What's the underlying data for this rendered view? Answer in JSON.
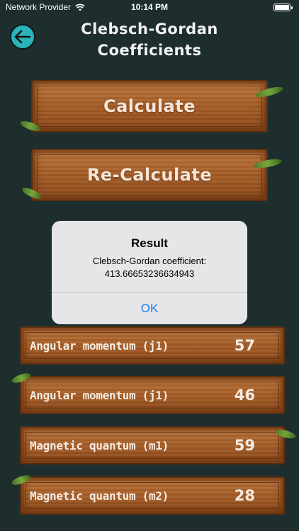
{
  "status": {
    "carrier": "Network Provider",
    "time": "10:14 PM"
  },
  "header": {
    "title_line1": "Clebsch-Gordan",
    "title_line2": "Coefficients"
  },
  "buttons": {
    "calculate": "Calculate",
    "recalculate": "Re-Calculate"
  },
  "inputs": [
    {
      "label": "Angular momentum (j1)",
      "value": "57"
    },
    {
      "label": "Angular momentum (j1)",
      "value": "46"
    },
    {
      "label": "Magnetic quantum (m1)",
      "value": "59"
    },
    {
      "label": "Magnetic quantum (m2)",
      "value": "28"
    }
  ],
  "alert": {
    "title": "Result",
    "message_line1": "Clebsch-Gordan coefficient:",
    "message_line2": "413.66653236634943",
    "ok": "OK"
  },
  "colors": {
    "background": "#1e2e2e",
    "accent_back": "#2ab3b8",
    "alert_link": "#1a7cf0"
  }
}
